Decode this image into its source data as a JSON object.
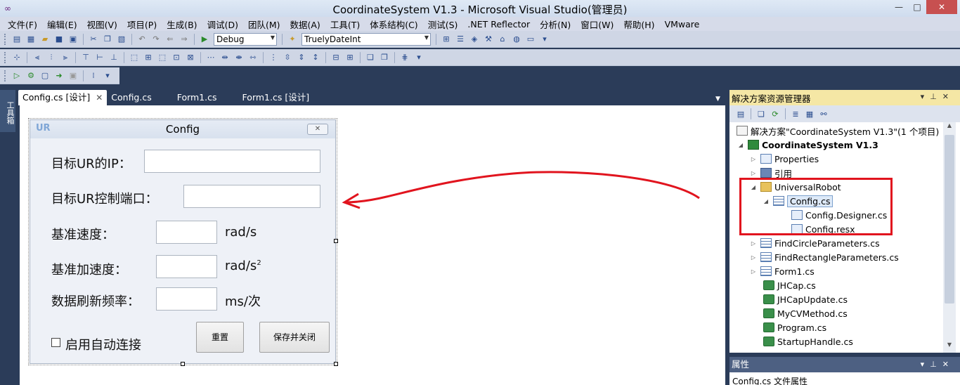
{
  "window": {
    "title": "CoordinateSystem V1.3 - Microsoft Visual Studio(管理员)",
    "min": "—",
    "max": "□",
    "close": "✕"
  },
  "menu": [
    "文件(F)",
    "编辑(E)",
    "视图(V)",
    "项目(P)",
    "生成(B)",
    "调试(D)",
    "团队(M)",
    "数据(A)",
    "工具(T)",
    "体系结构(C)",
    "测试(S)",
    ".NET Reflector",
    "分析(N)",
    "窗口(W)",
    "帮助(H)",
    "VMware"
  ],
  "toolbar": {
    "config_combo": "Debug",
    "platform_combo": "TruelyDateInt"
  },
  "toolbox_strip": "工具箱",
  "doc_tabs": [
    {
      "label": "Config.cs [设计]",
      "active": true
    },
    {
      "label": "Config.cs",
      "active": false
    },
    {
      "label": "Form1.cs",
      "active": false
    },
    {
      "label": "Form1.cs [设计]",
      "active": false
    }
  ],
  "form": {
    "title": "Config",
    "icon_text": "UR",
    "labels": {
      "ip": "目标UR的IP：",
      "port": "目标UR控制端口：",
      "speed": "基准速度：",
      "accel": "基准加速度：",
      "refresh": "数据刷新频率："
    },
    "units": {
      "speed": "rad/s",
      "accel": "rad/s",
      "accel_sup": "2",
      "refresh": "ms/次"
    },
    "checkbox_label": "启用自动连接",
    "reset_button": "重置",
    "save_button": "保存并关闭"
  },
  "solution_explorer": {
    "title": "解决方案资源管理器",
    "nodes": [
      {
        "label": "解决方案\"CoordinateSystem V1.3\"(1 个项目)",
        "icon": "solution-icon"
      },
      {
        "label": "CoordinateSystem V1.3",
        "icon": "project-icon"
      },
      {
        "label": "Properties",
        "icon": "properties-icon"
      },
      {
        "label": "引用",
        "icon": "references-icon"
      },
      {
        "label": "UniversalRobot",
        "icon": "folder-icon"
      },
      {
        "label": "Config.cs",
        "icon": "form-file-icon"
      },
      {
        "label": "Config.Designer.cs",
        "icon": "designer-file-icon"
      },
      {
        "label": "Config.resx",
        "icon": "resx-file-icon"
      },
      {
        "label": "FindCircleParameters.cs",
        "icon": "form-file-icon"
      },
      {
        "label": "FindRectangleParameters.cs",
        "icon": "form-file-icon"
      },
      {
        "label": "Form1.cs",
        "icon": "form-file-icon"
      },
      {
        "label": "JHCap.cs",
        "icon": "cs-file-icon"
      },
      {
        "label": "JHCapUpdate.cs",
        "icon": "cs-file-icon"
      },
      {
        "label": "MyCVMethod.cs",
        "icon": "cs-file-icon"
      },
      {
        "label": "Program.cs",
        "icon": "cs-file-icon"
      },
      {
        "label": "StartupHandle.cs",
        "icon": "cs-file-icon"
      }
    ]
  },
  "properties": {
    "title": "属性",
    "row": "Config.cs 文件属性"
  },
  "colors": {
    "annotation_red": "#e1141e",
    "panel_header": "#f5e7a5",
    "ide_background": "#2b3c59"
  }
}
